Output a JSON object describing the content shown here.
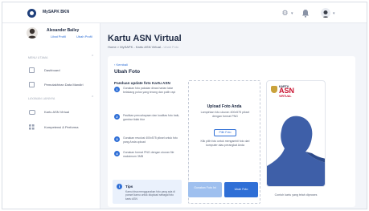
{
  "app": {
    "title": "MySAPK BKN"
  },
  "user": {
    "name": "Alexander Bailey",
    "link_profile": "Lihat Profil",
    "link_edit": "Ubah Profil"
  },
  "sidebar": {
    "sections": [
      {
        "title": "MENU UTAMA",
        "items": [
          {
            "label": "Dashboard",
            "icon": "dashboard-icon"
          },
          {
            "label": "Pemutakhiran Data Mandiri",
            "icon": "document-icon"
          }
        ]
      },
      {
        "title": "LAYANAN LAINNYA",
        "items": [
          {
            "label": "Kartu ASN Virtual",
            "icon": "id-card-icon"
          },
          {
            "label": "Kompetensi & Performa",
            "icon": "grid-icon"
          }
        ]
      }
    ]
  },
  "main": {
    "title": "Kartu ASN Virtual",
    "breadcrumb": [
      "Home",
      "MySAPK",
      "Kartu ASN Virtual",
      "Ubah Foto"
    ],
    "back_label": "Kembali",
    "card_title": "Ubah Foto",
    "guide": {
      "title": "Panduan update foto Kartu ASN",
      "steps": [
        {
          "num": "1",
          "text": "Gunakan foto pakaian dinas harian latar belakang polos yang terang dan putih rapi"
        },
        {
          "num": "2",
          "text": "Pastikan pencahayaan dan kualitas foto baik, gambar tidak blur"
        },
        {
          "num": "3",
          "text": "Gunakan resolusi 400x575 piksel untuk foto yang Anda upload"
        },
        {
          "num": "4",
          "text": "Gunakan format PNG dengan ukuran file maksimum 3MB"
        }
      ]
    },
    "tips": {
      "title": "Tips",
      "text": "Kamu bisa menggunakan foto yang ada di ponsel kamu untuk diupload sebagai foto kartu ASN"
    },
    "upload": {
      "title": "Upload Foto Anda",
      "desc": "Lampirkan foto ukuran 400x575 piksel dengan format PNG",
      "button": "Pilih Foto",
      "note": "Klik pilih foto untuk mengambil foto dari komputer atau perangkat Anda"
    },
    "actions": {
      "cancel": "Gunakan Foto Ini",
      "upload": "Ubah Foto"
    },
    "preview": {
      "brand_top": "KARTU",
      "brand_asn": "ASN",
      "brand_bottom": "VIRTUAL",
      "caption": "Contoh kartu yang telah diproses"
    }
  },
  "colors": {
    "primary": "#2f6fd6",
    "brand_red": "#c8102e",
    "navy": "#1e2a44"
  }
}
